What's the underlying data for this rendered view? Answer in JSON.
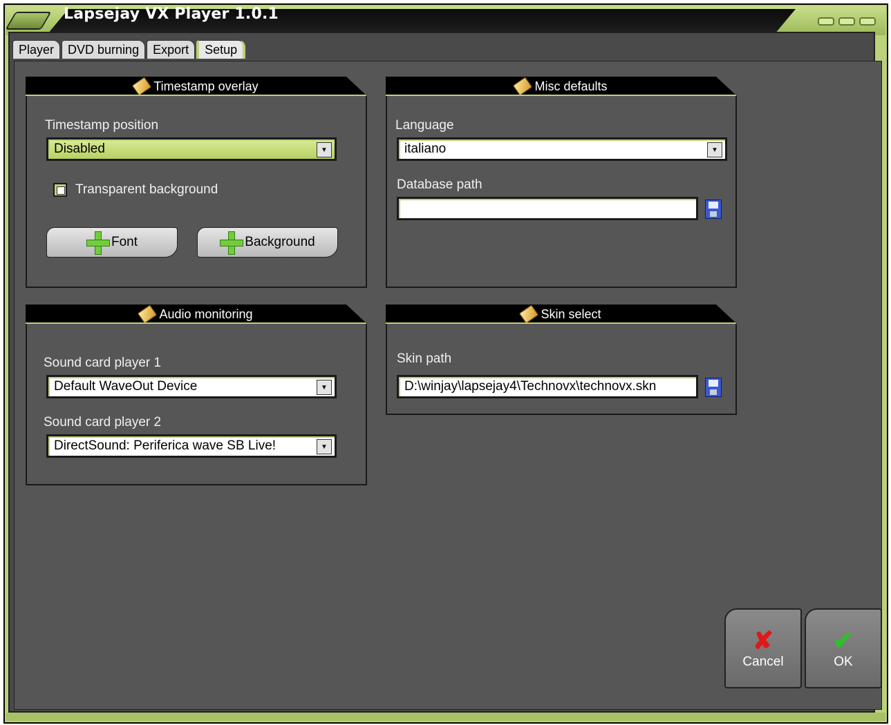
{
  "window": {
    "title": "Lapsejay VX Player 1.0.1"
  },
  "tabs": [
    {
      "label": "Player"
    },
    {
      "label": "DVD burning"
    },
    {
      "label": "Export"
    },
    {
      "label": "Setup"
    }
  ],
  "timestamp_overlay": {
    "heading": "Timestamp overlay",
    "position_label": "Timestamp position",
    "position_value": "Disabled",
    "transparent_label": "Transparent background",
    "font_button": "Font",
    "background_button": "Background"
  },
  "misc_defaults": {
    "heading": "Misc defaults",
    "language_label": "Language",
    "language_value": "italiano",
    "database_label": "Database path",
    "database_value": ""
  },
  "audio_monitoring": {
    "heading": "Audio monitoring",
    "player1_label": "Sound card player 1",
    "player1_value": "Default WaveOut Device",
    "player2_label": "Sound card player 2",
    "player2_value": "DirectSound: Periferica wave SB Live!"
  },
  "skin_select": {
    "heading": "Skin select",
    "path_label": "Skin path",
    "path_value": "D:\\winjay\\lapsejay4\\Technovx\\technovx.skn"
  },
  "actions": {
    "cancel": "Cancel",
    "ok": "OK"
  }
}
